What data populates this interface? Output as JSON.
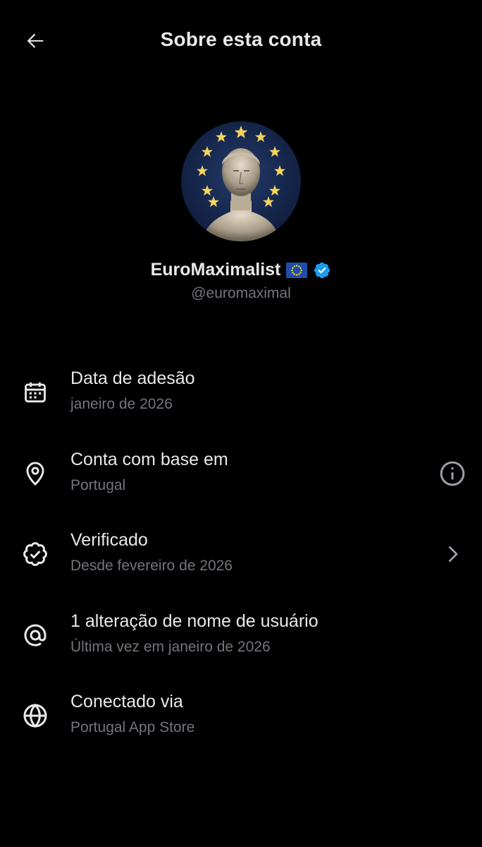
{
  "header": {
    "title": "Sobre esta conta",
    "back_icon": "arrow-left-icon"
  },
  "profile": {
    "display_name": "EuroMaximalist",
    "flag_icon": "eu-flag-icon",
    "verified_icon": "verified-badge-icon",
    "handle": "@euromaximal"
  },
  "rows": [
    {
      "icon": "calendar-icon",
      "title": "Data de adesão",
      "subtitle": "janeiro de 2026"
    },
    {
      "icon": "location-pin-icon",
      "title": "Conta com base em",
      "subtitle": "Portugal",
      "trailing": "info-icon"
    },
    {
      "icon": "verified-outline-icon",
      "title": "Verificado",
      "subtitle": "Desde fevereiro de 2026",
      "trailing": "chevron-right-icon"
    },
    {
      "icon": "at-sign-icon",
      "title": "1 alteração de nome de usuário",
      "subtitle": "Última vez em janeiro de 2026"
    },
    {
      "icon": "globe-icon",
      "title": "Conectado via",
      "subtitle": "Portugal App Store"
    }
  ],
  "colors": {
    "background": "#000000",
    "primary_text": "#e7e9ea",
    "secondary_text": "#71767b",
    "verified_blue": "#1d9bf0",
    "avatar_background": "#15254a",
    "star_gold": "#f4d35e"
  }
}
